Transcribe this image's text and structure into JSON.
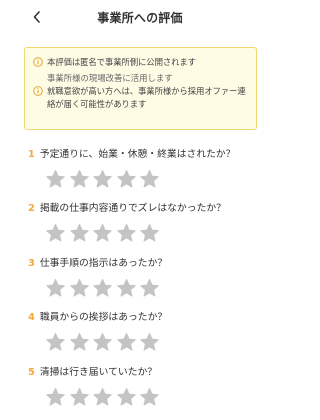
{
  "header": {
    "title": "事業所への評価"
  },
  "notice": {
    "line1": "本評価は匿名で事業所側に公開されます",
    "line1_sub": "事業所様の現場改善に活用します",
    "line2": "就職意欲が高い方へは、事業所様から採用オファー連絡が届く可能性があります"
  },
  "questions": [
    {
      "num": "1",
      "text": "予定通りに、始業・休憩・終業はされたか？",
      "rating": 0
    },
    {
      "num": "2",
      "text": "掲載の仕事内容通りでズレはなかったか？",
      "rating": 0
    },
    {
      "num": "3",
      "text": "仕事手順の指示はあったか？",
      "rating": 0
    },
    {
      "num": "4",
      "text": "職員からの挨拶はあったか？",
      "rating": 0
    },
    {
      "num": "5",
      "text": "清掃は行き届いていたか？",
      "rating": 0
    }
  ],
  "colors": {
    "accent": "#f2a93b",
    "star_empty": "#c4c4c4",
    "notice_bg": "#fffce6",
    "notice_border": "#f0d870"
  },
  "icons": {
    "back": "chevron-left-icon",
    "info": "info-circle-icon",
    "star": "star-icon"
  }
}
